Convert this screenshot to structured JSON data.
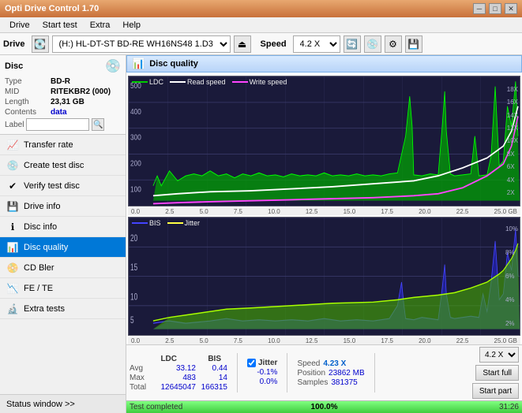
{
  "titlebar": {
    "title": "Opti Drive Control 1.70",
    "minimize": "─",
    "maximize": "□",
    "close": "✕"
  },
  "menubar": {
    "items": [
      "Drive",
      "Start test",
      "Extra",
      "Help"
    ]
  },
  "drivebar": {
    "label": "Drive",
    "drive_value": "(H:) HL-DT-ST BD-RE  WH16NS48 1.D3",
    "speed_label": "Speed",
    "speed_value": "4.2 X"
  },
  "disc": {
    "title": "Disc",
    "type_label": "Type",
    "type_value": "BD-R",
    "mid_label": "MID",
    "mid_value": "RITEKBR2 (000)",
    "length_label": "Length",
    "length_value": "23,31 GB",
    "contents_label": "Contents",
    "contents_value": "data",
    "label_label": "Label"
  },
  "sidebar": {
    "items": [
      {
        "id": "transfer-rate",
        "label": "Transfer rate",
        "icon": "📈"
      },
      {
        "id": "create-test-disc",
        "label": "Create test disc",
        "icon": "💿"
      },
      {
        "id": "verify-test-disc",
        "label": "Verify test disc",
        "icon": "✔"
      },
      {
        "id": "drive-info",
        "label": "Drive info",
        "icon": "💾"
      },
      {
        "id": "disc-info",
        "label": "Disc info",
        "icon": "ℹ"
      },
      {
        "id": "disc-quality",
        "label": "Disc quality",
        "icon": "📊",
        "active": true
      },
      {
        "id": "cd-bler",
        "label": "CD Bler",
        "icon": "📀"
      },
      {
        "id": "fe-te",
        "label": "FE / TE",
        "icon": "📉"
      },
      {
        "id": "extra-tests",
        "label": "Extra tests",
        "icon": "🔬"
      }
    ],
    "status_window": "Status window >>"
  },
  "quality_panel": {
    "title": "Disc quality",
    "legend": {
      "ldc": "LDC",
      "read_speed": "Read speed",
      "write_speed": "Write speed",
      "bis": "BIS",
      "jitter": "Jitter"
    },
    "upper_y_labels": [
      "500",
      "400",
      "300",
      "200",
      "100"
    ],
    "upper_y_right": [
      "18X",
      "16X",
      "14X",
      "12X",
      "10X",
      "8X",
      "6X",
      "4X",
      "2X"
    ],
    "lower_y_labels": [
      "20",
      "15",
      "10",
      "5"
    ],
    "lower_y_right": [
      "10%",
      "8%",
      "6%",
      "4%",
      "2%"
    ],
    "x_labels": [
      "0.0",
      "2.5",
      "5.0",
      "7.5",
      "10.0",
      "12.5",
      "15.0",
      "17.5",
      "20.0",
      "22.5",
      "25.0 GB"
    ]
  },
  "stats": {
    "headers": [
      "",
      "LDC",
      "BIS",
      "",
      "Jitter",
      "Speed",
      ""
    ],
    "avg_label": "Avg",
    "avg_ldc": "33.12",
    "avg_bis": "0.44",
    "avg_jitter": "-0.1%",
    "max_label": "Max",
    "max_ldc": "483",
    "max_bis": "14",
    "max_jitter": "0.0%",
    "total_label": "Total",
    "total_ldc": "12645047",
    "total_bis": "166315",
    "speed_label": "Speed",
    "speed_value": "4.23 X",
    "position_label": "Position",
    "position_value": "23862 MB",
    "samples_label": "Samples",
    "samples_value": "381375",
    "speed_select": "4.2 X",
    "start_full": "Start full",
    "start_part": "Start part"
  },
  "progress": {
    "status": "Test completed",
    "percent": "100.0%",
    "time": "31:26",
    "fill_percent": 100
  },
  "colors": {
    "ldc_green": "#40ff40",
    "read_speed_white": "#ffffff",
    "write_speed_magenta": "#ff40ff",
    "bis_blue": "#4040ff",
    "jitter_yellow": "#ffff00",
    "chart_bg": "#1a1a3a",
    "grid_line": "#3a3a6a",
    "active_sidebar": "#0078d7"
  }
}
